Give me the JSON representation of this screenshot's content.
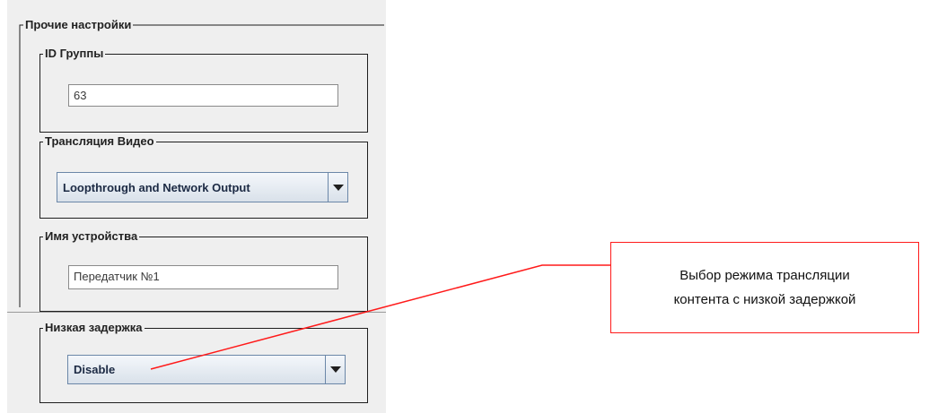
{
  "panel": {
    "title": "Прочие настройки",
    "group_id": {
      "title": "ID Группы",
      "value": "63"
    },
    "video_stream": {
      "title": "Трансляция Видео",
      "selected": "Loopthrough and Network Output"
    },
    "device_name": {
      "title": "Имя устройства",
      "value": "Передатчик №1"
    },
    "low_latency": {
      "title": "Низкая задержка",
      "selected": "Disable"
    }
  },
  "callout": {
    "line1": "Выбор режима трансляции",
    "line2": "контента с низкой задержкой",
    "color": "#ff1a1a"
  }
}
